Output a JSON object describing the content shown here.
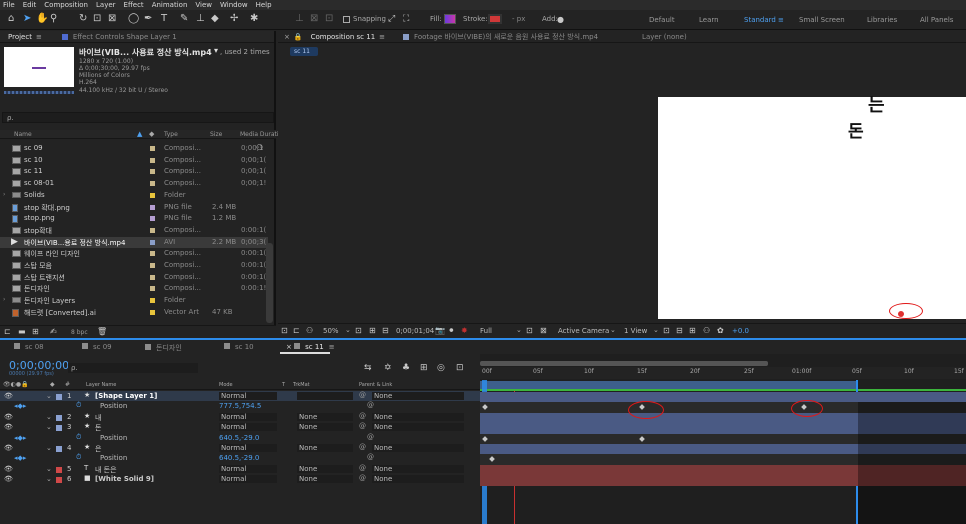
{
  "menu": [
    "File",
    "Edit",
    "Composition",
    "Layer",
    "Effect",
    "Animation",
    "View",
    "Window",
    "Help"
  ],
  "toolbar": {
    "snapping_label": "Snapping",
    "fill_label": "Fill:",
    "stroke_label": "Stroke:",
    "stroke_px": "- px",
    "add_label": "Add:",
    "workspaces": [
      "Default",
      "Learn",
      "Standard",
      "Small Screen",
      "Libraries",
      "All Panels"
    ],
    "active_workspace": "Standard"
  },
  "project_panel": {
    "tab_project": "Project",
    "tab_effect_controls": "Effect Controls Shape Layer 1",
    "footage_title": "바이브(VIB... 사용료 정산 방식.mp4",
    "footage_used": ", used 2 times",
    "footage_info": [
      "1280 x 720 (1.00)",
      "Δ 0;00;30;00, 29.97 fps",
      "Millions of Colors",
      "H.264",
      "44.100 kHz / 32 bit U / Stereo"
    ],
    "search_placeholder": "ρ.",
    "columns": [
      "Name",
      "Type",
      "Size",
      "Media Duratio"
    ],
    "items": [
      {
        "name": "sc 09",
        "type": "Composi...",
        "size": "",
        "dur": "0;00;1",
        "color": "#c9b88a",
        "kind": "comp"
      },
      {
        "name": "sc 10",
        "type": "Composi...",
        "size": "",
        "dur": "0;00;1(",
        "color": "#c9b88a",
        "kind": "comp"
      },
      {
        "name": "sc 11",
        "type": "Composi...",
        "size": "",
        "dur": "0;00;1(",
        "color": "#c9b88a",
        "kind": "comp"
      },
      {
        "name": "sc 08-01",
        "type": "Composi...",
        "size": "",
        "dur": "0;00;1!",
        "color": "#c9b88a",
        "kind": "comp"
      },
      {
        "name": "Solids",
        "type": "Folder",
        "size": "",
        "dur": "",
        "color": "#e8c43c",
        "kind": "folder"
      },
      {
        "name": "stop 확대.png",
        "type": "PNG file",
        "size": "2.4 MB",
        "dur": "",
        "color": "#b59ed2",
        "kind": "file"
      },
      {
        "name": "stop.png",
        "type": "PNG file",
        "size": "1.2 MB",
        "dur": "",
        "color": "#b59ed2",
        "kind": "file"
      },
      {
        "name": "stop확대",
        "type": "Composi...",
        "size": "",
        "dur": "0:00:1(",
        "color": "#c9b88a",
        "kind": "comp"
      },
      {
        "name": "바이브(VIB...용료 정산 방식.mp4",
        "type": "AVI",
        "size": "2.2 MB",
        "dur": "0;00;3(",
        "color": "#8a9ec8",
        "kind": "video"
      },
      {
        "name": "웨이프 라인 디자인",
        "type": "Composi...",
        "size": "",
        "dur": "0:00:1(",
        "color": "#c9b88a",
        "kind": "comp"
      },
      {
        "name": "스탑 모음",
        "type": "Composi...",
        "size": "",
        "dur": "0:00:1(",
        "color": "#c9b88a",
        "kind": "comp"
      },
      {
        "name": "스탑 트랜지션",
        "type": "Composi...",
        "size": "",
        "dur": "0:00:1(",
        "color": "#c9b88a",
        "kind": "comp"
      },
      {
        "name": "돈디자인",
        "type": "Composi...",
        "size": "",
        "dur": "0:00:1!",
        "color": "#c9b88a",
        "kind": "comp"
      },
      {
        "name": "돈디자인 Layers",
        "type": "Folder",
        "size": "",
        "dur": "",
        "color": "#e8c43c",
        "kind": "folder"
      },
      {
        "name": "해드렷 [Converted].ai",
        "type": "Vector Art",
        "size": "47 KB",
        "dur": "",
        "color": "#e8c43c",
        "kind": "ai"
      }
    ],
    "footer_bpc": "8 bpc"
  },
  "viewer": {
    "tab_comp": "Composition sc 11",
    "tab_footage": "Footage 바이브(VIBE)의 새로운 음원 사용료 정산 방식.mp4",
    "tab_layer": "Layer (none)",
    "comp_chip": "sc 11",
    "canvas_text_top": "는",
    "canvas_text": "돈",
    "zoom": "50%",
    "timecode": "0;00;01;04",
    "resolution": "Full",
    "camera": "Active Camera",
    "views": "1 View",
    "exposure": "+0.0"
  },
  "timeline": {
    "tabs": [
      "sc 08",
      "sc 09",
      "돈디자인",
      "sc 10",
      "sc 11"
    ],
    "active_tab": "sc 11",
    "timecode": "0;00;00;00",
    "timecode_sub": "00000 (29.97 fps)",
    "search_placeholder": "ρ.",
    "col_layer_name": "Layer Name",
    "col_mode": "Mode",
    "col_t": "T",
    "col_trkmat": "TrkMat",
    "col_parent": "Parent & Link",
    "ruler": [
      "00f",
      "05f",
      "10f",
      "15f",
      "20f",
      "25f",
      "01:00f",
      "05f",
      "10f",
      "15f"
    ],
    "rows": [
      {
        "num": "1",
        "icon": "★",
        "name": "[Shape Layer 1]",
        "mode": "Normal",
        "trkmat": "",
        "parent": "None",
        "type": "layer",
        "color": "#8aa0d0"
      },
      {
        "prop": "Position",
        "value": "777.5,754.5",
        "type": "prop"
      },
      {
        "num": "2",
        "icon": "★",
        "name": "내",
        "mode": "Normal",
        "trkmat": "None",
        "parent": "None",
        "type": "layer",
        "color": "#8aa0d0"
      },
      {
        "num": "3",
        "icon": "★",
        "name": "돈",
        "mode": "Normal",
        "trkmat": "None",
        "parent": "None",
        "type": "layer",
        "color": "#8aa0d0"
      },
      {
        "prop": "Position",
        "value": "640.5,-29.0",
        "type": "prop"
      },
      {
        "num": "4",
        "icon": "★",
        "name": "은",
        "mode": "Normal",
        "trkmat": "None",
        "parent": "None",
        "type": "layer",
        "color": "#8aa0d0"
      },
      {
        "prop": "Position",
        "value": "640.5,-29.0",
        "type": "prop"
      },
      {
        "num": "5",
        "icon": "T",
        "name": "내 돈은",
        "mode": "Normal",
        "trkmat": "None",
        "parent": "None",
        "type": "layer",
        "color": "#d04848"
      },
      {
        "num": "6",
        "icon": "■",
        "name": "[White Solid 9]",
        "mode": "Normal",
        "trkmat": "None",
        "parent": "None",
        "type": "layer",
        "color": "#d04848"
      }
    ]
  },
  "colors": {
    "accent": "#2d8ceb",
    "panel": "#232323",
    "annotation": "#e01818"
  }
}
